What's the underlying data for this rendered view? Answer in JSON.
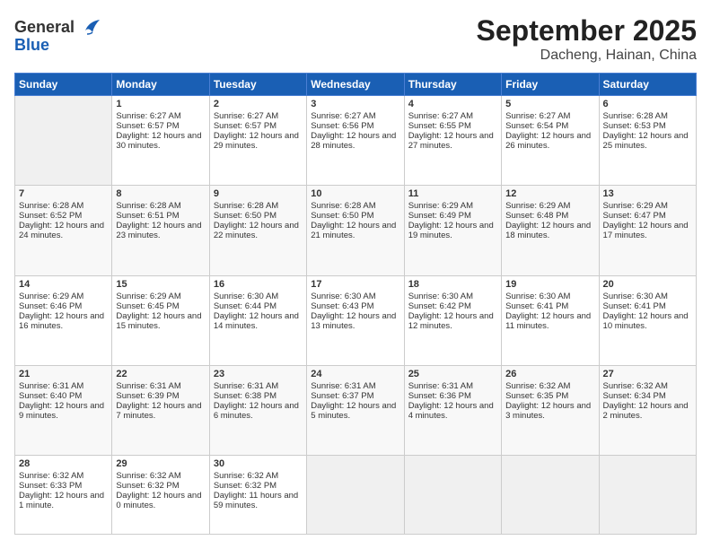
{
  "header": {
    "logo_line1": "General",
    "logo_line2": "Blue",
    "month": "September 2025",
    "location": "Dacheng, Hainan, China"
  },
  "weekdays": [
    "Sunday",
    "Monday",
    "Tuesday",
    "Wednesday",
    "Thursday",
    "Friday",
    "Saturday"
  ],
  "weeks": [
    [
      {
        "day": "",
        "sunrise": "",
        "sunset": "",
        "daylight": ""
      },
      {
        "day": "1",
        "sunrise": "Sunrise: 6:27 AM",
        "sunset": "Sunset: 6:57 PM",
        "daylight": "Daylight: 12 hours and 30 minutes."
      },
      {
        "day": "2",
        "sunrise": "Sunrise: 6:27 AM",
        "sunset": "Sunset: 6:57 PM",
        "daylight": "Daylight: 12 hours and 29 minutes."
      },
      {
        "day": "3",
        "sunrise": "Sunrise: 6:27 AM",
        "sunset": "Sunset: 6:56 PM",
        "daylight": "Daylight: 12 hours and 28 minutes."
      },
      {
        "day": "4",
        "sunrise": "Sunrise: 6:27 AM",
        "sunset": "Sunset: 6:55 PM",
        "daylight": "Daylight: 12 hours and 27 minutes."
      },
      {
        "day": "5",
        "sunrise": "Sunrise: 6:27 AM",
        "sunset": "Sunset: 6:54 PM",
        "daylight": "Daylight: 12 hours and 26 minutes."
      },
      {
        "day": "6",
        "sunrise": "Sunrise: 6:28 AM",
        "sunset": "Sunset: 6:53 PM",
        "daylight": "Daylight: 12 hours and 25 minutes."
      }
    ],
    [
      {
        "day": "7",
        "sunrise": "Sunrise: 6:28 AM",
        "sunset": "Sunset: 6:52 PM",
        "daylight": "Daylight: 12 hours and 24 minutes."
      },
      {
        "day": "8",
        "sunrise": "Sunrise: 6:28 AM",
        "sunset": "Sunset: 6:51 PM",
        "daylight": "Daylight: 12 hours and 23 minutes."
      },
      {
        "day": "9",
        "sunrise": "Sunrise: 6:28 AM",
        "sunset": "Sunset: 6:50 PM",
        "daylight": "Daylight: 12 hours and 22 minutes."
      },
      {
        "day": "10",
        "sunrise": "Sunrise: 6:28 AM",
        "sunset": "Sunset: 6:50 PM",
        "daylight": "Daylight: 12 hours and 21 minutes."
      },
      {
        "day": "11",
        "sunrise": "Sunrise: 6:29 AM",
        "sunset": "Sunset: 6:49 PM",
        "daylight": "Daylight: 12 hours and 19 minutes."
      },
      {
        "day": "12",
        "sunrise": "Sunrise: 6:29 AM",
        "sunset": "Sunset: 6:48 PM",
        "daylight": "Daylight: 12 hours and 18 minutes."
      },
      {
        "day": "13",
        "sunrise": "Sunrise: 6:29 AM",
        "sunset": "Sunset: 6:47 PM",
        "daylight": "Daylight: 12 hours and 17 minutes."
      }
    ],
    [
      {
        "day": "14",
        "sunrise": "Sunrise: 6:29 AM",
        "sunset": "Sunset: 6:46 PM",
        "daylight": "Daylight: 12 hours and 16 minutes."
      },
      {
        "day": "15",
        "sunrise": "Sunrise: 6:29 AM",
        "sunset": "Sunset: 6:45 PM",
        "daylight": "Daylight: 12 hours and 15 minutes."
      },
      {
        "day": "16",
        "sunrise": "Sunrise: 6:30 AM",
        "sunset": "Sunset: 6:44 PM",
        "daylight": "Daylight: 12 hours and 14 minutes."
      },
      {
        "day": "17",
        "sunrise": "Sunrise: 6:30 AM",
        "sunset": "Sunset: 6:43 PM",
        "daylight": "Daylight: 12 hours and 13 minutes."
      },
      {
        "day": "18",
        "sunrise": "Sunrise: 6:30 AM",
        "sunset": "Sunset: 6:42 PM",
        "daylight": "Daylight: 12 hours and 12 minutes."
      },
      {
        "day": "19",
        "sunrise": "Sunrise: 6:30 AM",
        "sunset": "Sunset: 6:41 PM",
        "daylight": "Daylight: 12 hours and 11 minutes."
      },
      {
        "day": "20",
        "sunrise": "Sunrise: 6:30 AM",
        "sunset": "Sunset: 6:41 PM",
        "daylight": "Daylight: 12 hours and 10 minutes."
      }
    ],
    [
      {
        "day": "21",
        "sunrise": "Sunrise: 6:31 AM",
        "sunset": "Sunset: 6:40 PM",
        "daylight": "Daylight: 12 hours and 9 minutes."
      },
      {
        "day": "22",
        "sunrise": "Sunrise: 6:31 AM",
        "sunset": "Sunset: 6:39 PM",
        "daylight": "Daylight: 12 hours and 7 minutes."
      },
      {
        "day": "23",
        "sunrise": "Sunrise: 6:31 AM",
        "sunset": "Sunset: 6:38 PM",
        "daylight": "Daylight: 12 hours and 6 minutes."
      },
      {
        "day": "24",
        "sunrise": "Sunrise: 6:31 AM",
        "sunset": "Sunset: 6:37 PM",
        "daylight": "Daylight: 12 hours and 5 minutes."
      },
      {
        "day": "25",
        "sunrise": "Sunrise: 6:31 AM",
        "sunset": "Sunset: 6:36 PM",
        "daylight": "Daylight: 12 hours and 4 minutes."
      },
      {
        "day": "26",
        "sunrise": "Sunrise: 6:32 AM",
        "sunset": "Sunset: 6:35 PM",
        "daylight": "Daylight: 12 hours and 3 minutes."
      },
      {
        "day": "27",
        "sunrise": "Sunrise: 6:32 AM",
        "sunset": "Sunset: 6:34 PM",
        "daylight": "Daylight: 12 hours and 2 minutes."
      }
    ],
    [
      {
        "day": "28",
        "sunrise": "Sunrise: 6:32 AM",
        "sunset": "Sunset: 6:33 PM",
        "daylight": "Daylight: 12 hours and 1 minute."
      },
      {
        "day": "29",
        "sunrise": "Sunrise: 6:32 AM",
        "sunset": "Sunset: 6:32 PM",
        "daylight": "Daylight: 12 hours and 0 minutes."
      },
      {
        "day": "30",
        "sunrise": "Sunrise: 6:32 AM",
        "sunset": "Sunset: 6:32 PM",
        "daylight": "Daylight: 11 hours and 59 minutes."
      },
      {
        "day": "",
        "sunrise": "",
        "sunset": "",
        "daylight": ""
      },
      {
        "day": "",
        "sunrise": "",
        "sunset": "",
        "daylight": ""
      },
      {
        "day": "",
        "sunrise": "",
        "sunset": "",
        "daylight": ""
      },
      {
        "day": "",
        "sunrise": "",
        "sunset": "",
        "daylight": ""
      }
    ]
  ]
}
